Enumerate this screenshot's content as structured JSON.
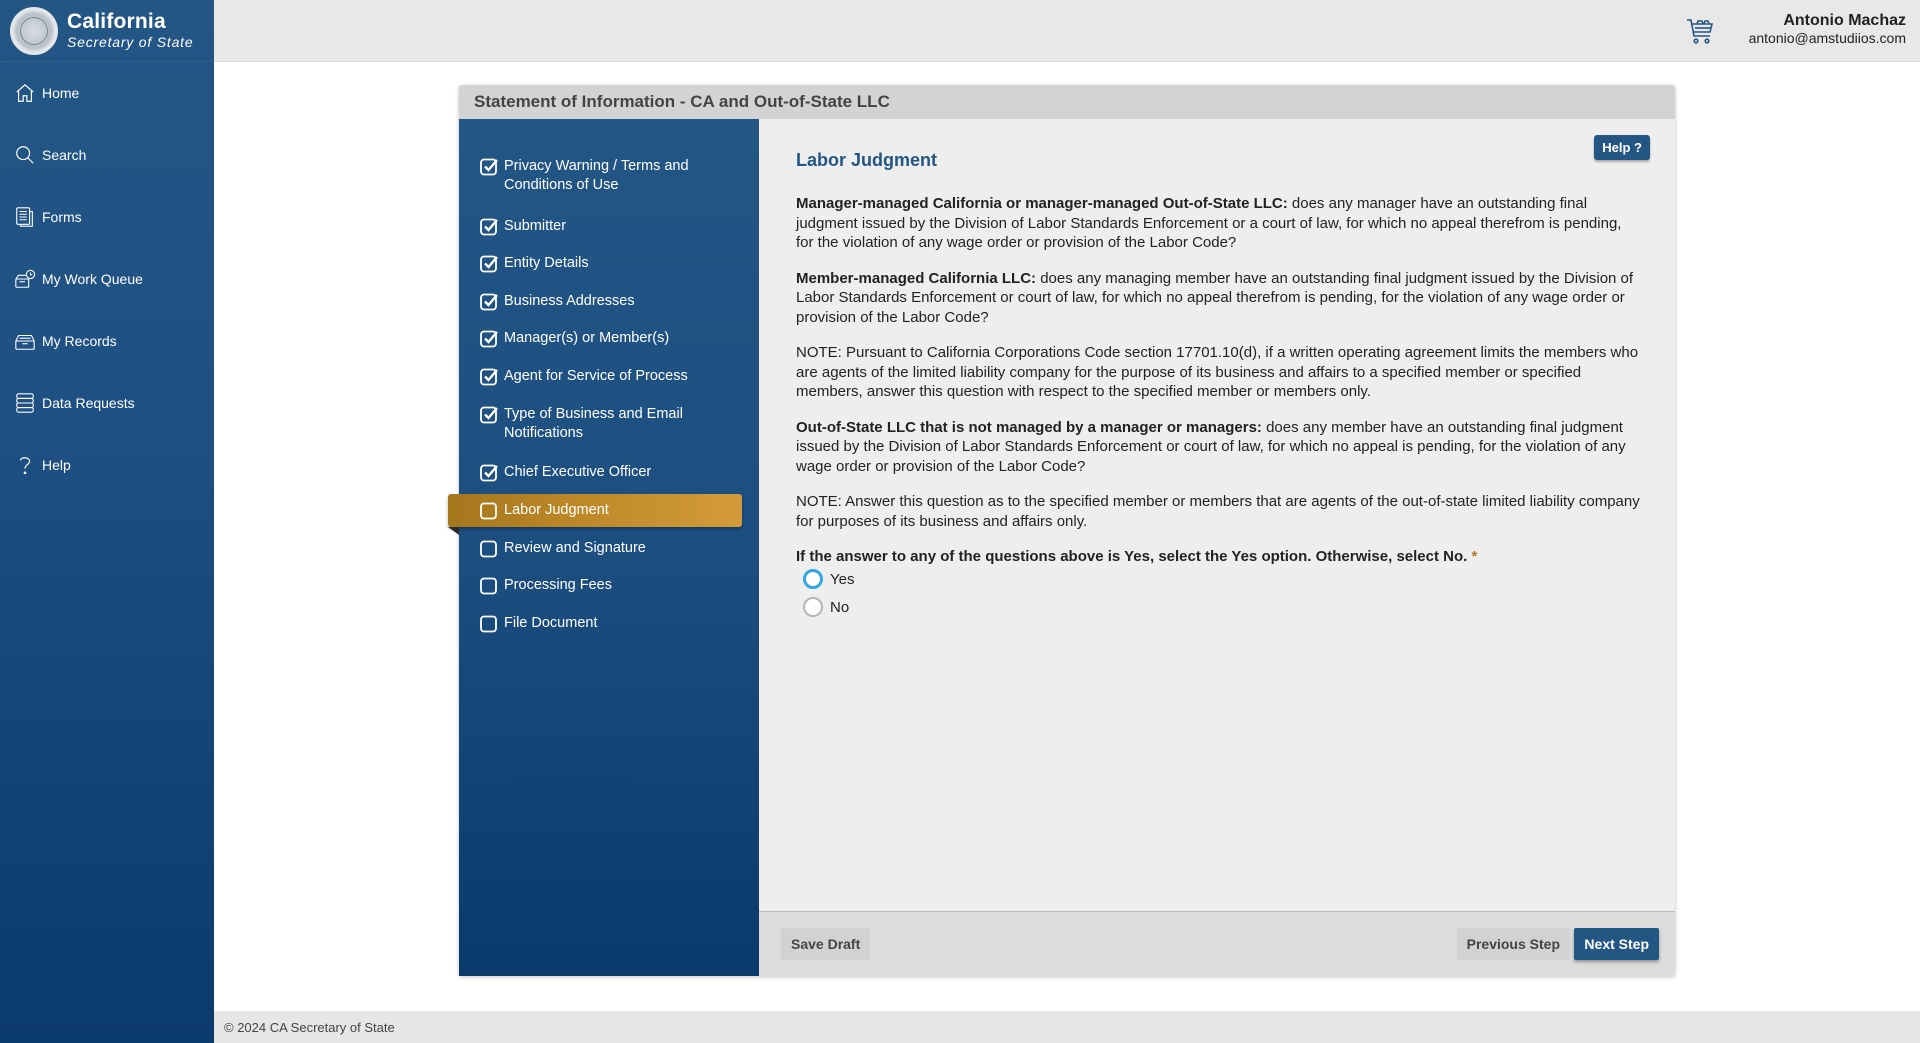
{
  "brand": {
    "title": "California",
    "subtitle": "Secretary of State"
  },
  "nav": {
    "items": [
      {
        "label": "Home",
        "icon": "home-icon"
      },
      {
        "label": "Search",
        "icon": "search-icon"
      },
      {
        "label": "Forms",
        "icon": "forms-icon"
      },
      {
        "label": "My Work Queue",
        "icon": "work-queue-icon"
      },
      {
        "label": "My Records",
        "icon": "records-icon"
      },
      {
        "label": "Data Requests",
        "icon": "database-icon"
      },
      {
        "label": "Help",
        "icon": "question-icon"
      }
    ]
  },
  "header": {
    "cart_icon": "cart-icon",
    "user_name": "Antonio Machaz",
    "user_email": "antonio@amstudiios.com"
  },
  "form": {
    "title": "Statement of Information - CA and Out-of-State LLC",
    "steps": [
      {
        "label": "Privacy Warning / Terms and Conditions of Use",
        "status": "complete"
      },
      {
        "label": "Submitter",
        "status": "complete"
      },
      {
        "label": "Entity Details",
        "status": "complete"
      },
      {
        "label": "Business Addresses",
        "status": "complete"
      },
      {
        "label": "Manager(s) or Member(s)",
        "status": "complete"
      },
      {
        "label": "Agent for Service of Process",
        "status": "complete"
      },
      {
        "label": "Type of Business and Email Notifications",
        "status": "complete"
      },
      {
        "label": "Chief Executive Officer",
        "status": "complete"
      },
      {
        "label": "Labor Judgment",
        "status": "current"
      },
      {
        "label": "Review and Signature",
        "status": "incomplete"
      },
      {
        "label": "Processing Fees",
        "status": "incomplete"
      },
      {
        "label": "File Document",
        "status": "incomplete"
      }
    ],
    "help_label": "Help ?",
    "section_title": "Labor Judgment",
    "paragraphs": [
      {
        "bold": "Manager-managed California or manager-managed Out-of-State LLC:",
        "text": " does any manager have an outstanding final judgment issued by the Division of Labor Standards Enforcement or a court of law, for which no appeal therefrom is pending, for the violation of any wage order or provision of the Labor Code?"
      },
      {
        "bold": "Member-managed California LLC:",
        "text": " does any managing member have an outstanding final judgment issued by the Division of Labor Standards Enforcement or court of law, for which no appeal therefrom is pending, for the violation of any wage order or provision of the Labor Code?"
      },
      {
        "bold": "",
        "text": "NOTE: Pursuant to California Corporations Code section 17701.10(d), if a written operating agreement limits the members who are agents of the limited liability company for the purpose of its business and affairs to a specified member or specified members, answer this question with respect to the specified member or members only."
      },
      {
        "bold": "Out-of-State LLC that is not managed by a manager or managers:",
        "text": " does any member have an outstanding final judgment issued by the Division of Labor Standards Enforcement or court of law, for which no appeal is pending, for the violation of any wage order or provision of the Labor Code?"
      },
      {
        "bold": "",
        "text": "NOTE: Answer this question as to the specified member or members that are agents of the out-of-state limited liability company for purposes of its business and affairs only."
      }
    ],
    "question": "If the answer to any of the questions above is Yes, select the Yes option. Otherwise, select No.",
    "required_marker": "*",
    "options": [
      {
        "label": "Yes",
        "selected": false,
        "focused": true
      },
      {
        "label": "No",
        "selected": false,
        "focused": false
      }
    ],
    "buttons": {
      "save_draft": "Save Draft",
      "previous": "Previous Step",
      "next": "Next Step"
    }
  },
  "footer": {
    "copyright": "© 2024 CA Secretary of State"
  },
  "colors": {
    "brand_blue": "#245683",
    "active_step_gold": "#c08a2a",
    "focus_ring": "#2fa8e0"
  }
}
